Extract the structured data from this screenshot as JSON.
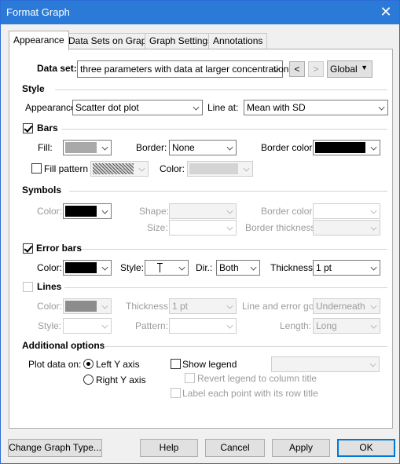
{
  "window": {
    "title": "Format Graph",
    "close_glyph": "✕"
  },
  "tabs": [
    {
      "label": "Appearance",
      "active": true
    },
    {
      "label": "Data Sets on Graph",
      "active": false
    },
    {
      "label": "Graph Settings",
      "active": false
    },
    {
      "label": "Annotations",
      "active": false
    }
  ],
  "dataset": {
    "label": "Data set:",
    "value": "three parameters with data at larger concentrations",
    "prev_label": "<",
    "next_label": ">",
    "scope_value": "Global"
  },
  "style": {
    "heading": "Style",
    "appearance_label": "Appearance:",
    "appearance_value": "Scatter dot plot",
    "line_at_label": "Line at:",
    "line_at_value": "Mean with SD"
  },
  "bars": {
    "heading": "Bars",
    "checked": true,
    "fill_label": "Fill:",
    "fill_color": "#a9a9a9",
    "border_label": "Border:",
    "border_value": "None",
    "border_color_label": "Border color:",
    "border_color": "#000000",
    "fill_pattern_label": "Fill pattern",
    "fill_pattern_checked": false,
    "color_label": "Color:",
    "color_value": "#d4d4d4"
  },
  "symbols": {
    "heading": "Symbols",
    "color_label": "Color:",
    "color_value": "#000000",
    "shape_label": "Shape:",
    "size_label": "Size:",
    "border_color_label": "Border color:",
    "border_thickness_label": "Border thickness:"
  },
  "error_bars": {
    "heading": "Error bars",
    "checked": true,
    "color_label": "Color:",
    "color_value": "#000000",
    "style_label": "Style:",
    "dir_label": "Dir.:",
    "dir_value": "Both",
    "thickness_label": "Thickness:",
    "thickness_value": "1 pt"
  },
  "lines": {
    "heading": "Lines",
    "checked": false,
    "color_label": "Color:",
    "color_value": "#8c8c8c",
    "thickness_label": "Thickness:",
    "thickness_value": "1 pt",
    "line_error_label": "Line and error go:",
    "line_error_value": "Underneath",
    "style_label": "Style:",
    "pattern_label": "Pattern:",
    "length_label": "Length:",
    "length_value": "Long"
  },
  "additional": {
    "heading": "Additional options",
    "plot_on_label": "Plot data on:",
    "left_axis_label": "Left Y axis",
    "left_axis_selected": true,
    "right_axis_label": "Right  Y axis",
    "show_legend_label": "Show legend",
    "revert_legend_label": "Revert legend to column title",
    "label_point_label": "Label each point with its row title"
  },
  "footer": {
    "change_type_label": "Change Graph Type...",
    "help_label": "Help",
    "cancel_label": "Cancel",
    "apply_label": "Apply",
    "ok_label": "OK"
  },
  "colors": {
    "titlebar": "#2b7ad8",
    "ok_border": "#0078d7"
  }
}
